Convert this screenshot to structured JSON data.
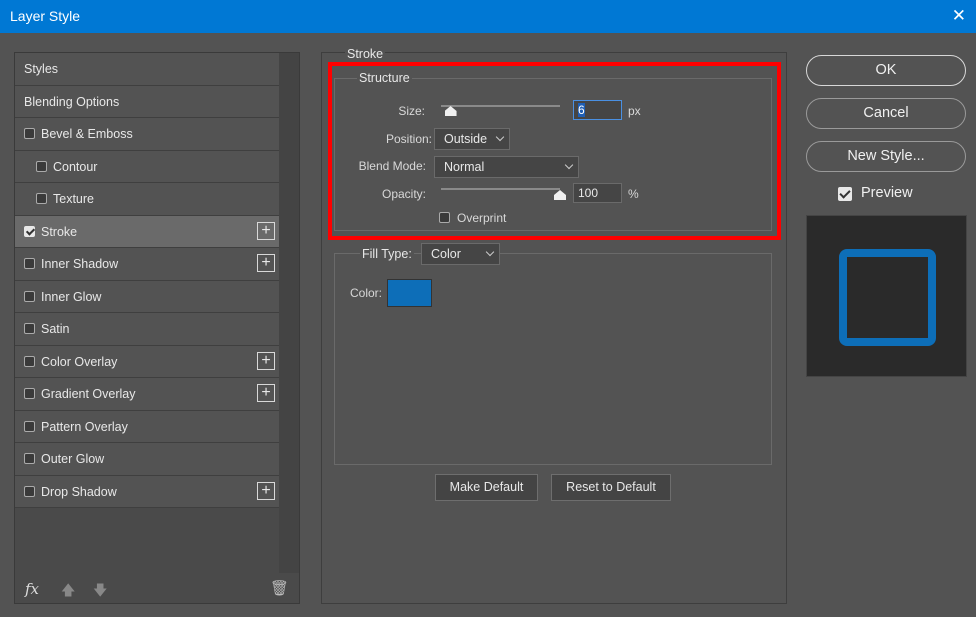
{
  "window": {
    "title": "Layer Style",
    "close_glyph": "✕"
  },
  "styles_list": [
    {
      "label": "Styles",
      "has_checkbox": false,
      "indent": false,
      "checked": false,
      "active": false,
      "has_plus": false
    },
    {
      "label": "Blending Options",
      "has_checkbox": false,
      "indent": false,
      "checked": false,
      "active": false,
      "has_plus": false
    },
    {
      "label": "Bevel & Emboss",
      "has_checkbox": true,
      "indent": false,
      "checked": false,
      "active": false,
      "has_plus": false
    },
    {
      "label": "Contour",
      "has_checkbox": true,
      "indent": true,
      "checked": false,
      "active": false,
      "has_plus": false
    },
    {
      "label": "Texture",
      "has_checkbox": true,
      "indent": true,
      "checked": false,
      "active": false,
      "has_plus": false
    },
    {
      "label": "Stroke",
      "has_checkbox": true,
      "indent": false,
      "checked": true,
      "active": true,
      "has_plus": true
    },
    {
      "label": "Inner Shadow",
      "has_checkbox": true,
      "indent": false,
      "checked": false,
      "active": false,
      "has_plus": true
    },
    {
      "label": "Inner Glow",
      "has_checkbox": true,
      "indent": false,
      "checked": false,
      "active": false,
      "has_plus": false
    },
    {
      "label": "Satin",
      "has_checkbox": true,
      "indent": false,
      "checked": false,
      "active": false,
      "has_plus": false
    },
    {
      "label": "Color Overlay",
      "has_checkbox": true,
      "indent": false,
      "checked": false,
      "active": false,
      "has_plus": true
    },
    {
      "label": "Gradient Overlay",
      "has_checkbox": true,
      "indent": false,
      "checked": false,
      "active": false,
      "has_plus": true
    },
    {
      "label": "Pattern Overlay",
      "has_checkbox": true,
      "indent": false,
      "checked": false,
      "active": false,
      "has_plus": false
    },
    {
      "label": "Outer Glow",
      "has_checkbox": true,
      "indent": false,
      "checked": false,
      "active": false,
      "has_plus": false
    },
    {
      "label": "Drop Shadow",
      "has_checkbox": true,
      "indent": false,
      "checked": false,
      "active": false,
      "has_plus": true
    }
  ],
  "footer": {
    "fx_label": "fx",
    "move_up_glyph": "🡅",
    "move_down_glyph": "🡇",
    "trash_glyph": "🗑"
  },
  "stroke": {
    "section_title": "Stroke",
    "structure": {
      "title": "Structure",
      "size_label": "Size:",
      "size_value": "6",
      "size_unit": "px",
      "size_fraction": 0.04,
      "position_label": "Position:",
      "position_value": "Outside",
      "blend_mode_label": "Blend Mode:",
      "blend_mode_value": "Normal",
      "opacity_label": "Opacity:",
      "opacity_value": "100",
      "opacity_unit": "%",
      "opacity_fraction": 1.0,
      "overprint_label": "Overprint",
      "overprint_checked": false
    },
    "fill": {
      "fill_type_label": "Fill Type:",
      "fill_type_value": "Color",
      "color_label": "Color:",
      "color_hex": "#0d6eb8"
    },
    "make_default_label": "Make Default",
    "reset_default_label": "Reset to Default"
  },
  "buttons": {
    "ok": "OK",
    "cancel": "Cancel",
    "new_style": "New Style..."
  },
  "preview": {
    "label": "Preview",
    "checked": true
  },
  "colors": {
    "titlebar": "#0078d4",
    "highlight": "#ff0000",
    "stroke_color": "#0d6eb8"
  }
}
